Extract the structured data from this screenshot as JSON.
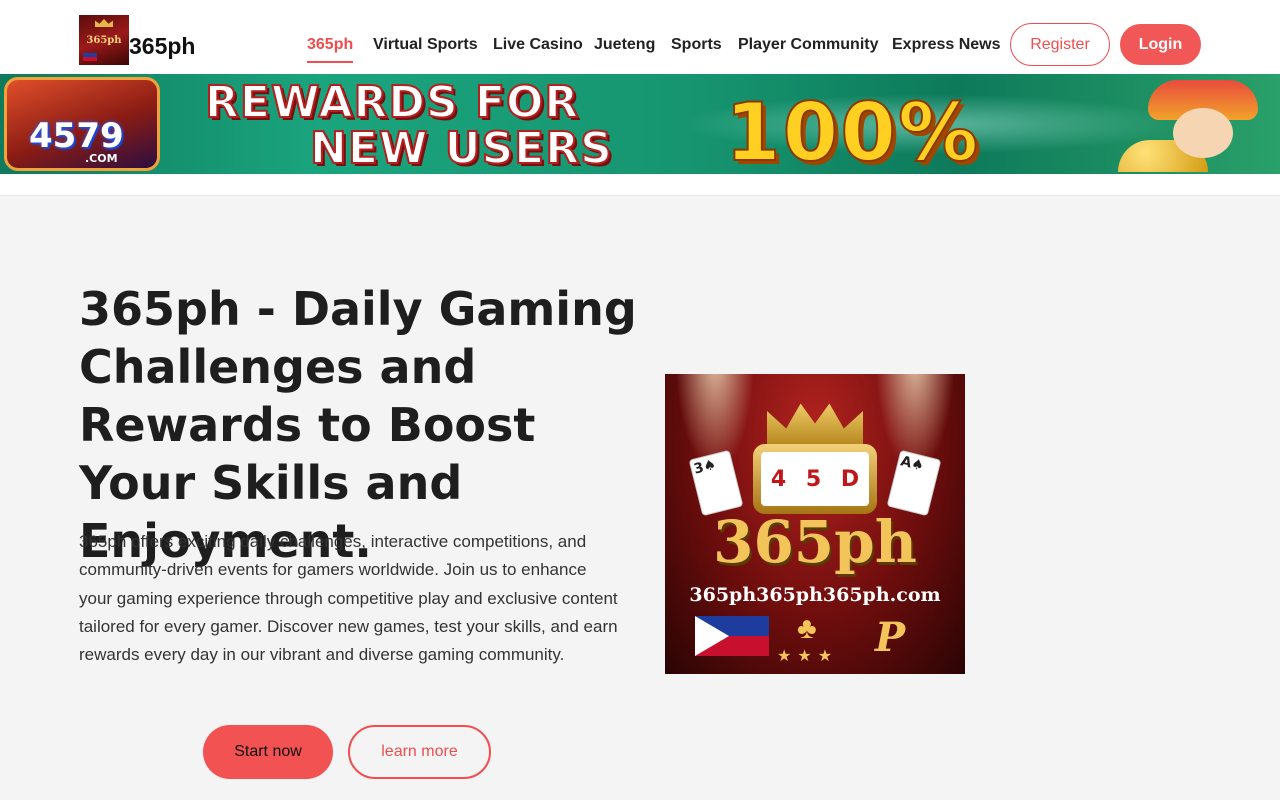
{
  "header": {
    "brand_name": "365ph",
    "logo_text": "365ph",
    "nav": [
      {
        "label": "365ph",
        "active": true
      },
      {
        "label": "Virtual Sports"
      },
      {
        "label": "Live Casino"
      },
      {
        "label": "Jueteng"
      },
      {
        "label": "Sports"
      },
      {
        "label": "Player Community"
      },
      {
        "label": "Express News"
      }
    ],
    "register_label": "Register",
    "login_label": "Login"
  },
  "banner": {
    "logo_number": "4579",
    "logo_domain": ".COM",
    "line1": "REWARDS FOR",
    "line2": "NEW USERS",
    "percent": "100%"
  },
  "hero": {
    "title": "365ph - Daily Gaming Challenges and Rewards to Boost Your Skills and Enjoyment.",
    "description": "365ph offers exciting daily challenges, interactive competitions, and community-driven events for gamers worldwide. Join us to enhance your gaming experience through competitive play and exclusive content tailored for every gamer. Discover new games, test your skills, and earn rewards every day in our vibrant and diverse gaming community.",
    "start_label": "Start now",
    "learn_label": "learn more",
    "image": {
      "reels": [
        "4",
        "5",
        "D"
      ],
      "title": "365ph",
      "url": "365ph365ph365ph.com",
      "p_mark": "P"
    }
  },
  "colors": {
    "accent": "#f04e4e",
    "login_bg": "#f25757",
    "page_bg": "#f4f4f4",
    "banner_green": "#16946f"
  }
}
